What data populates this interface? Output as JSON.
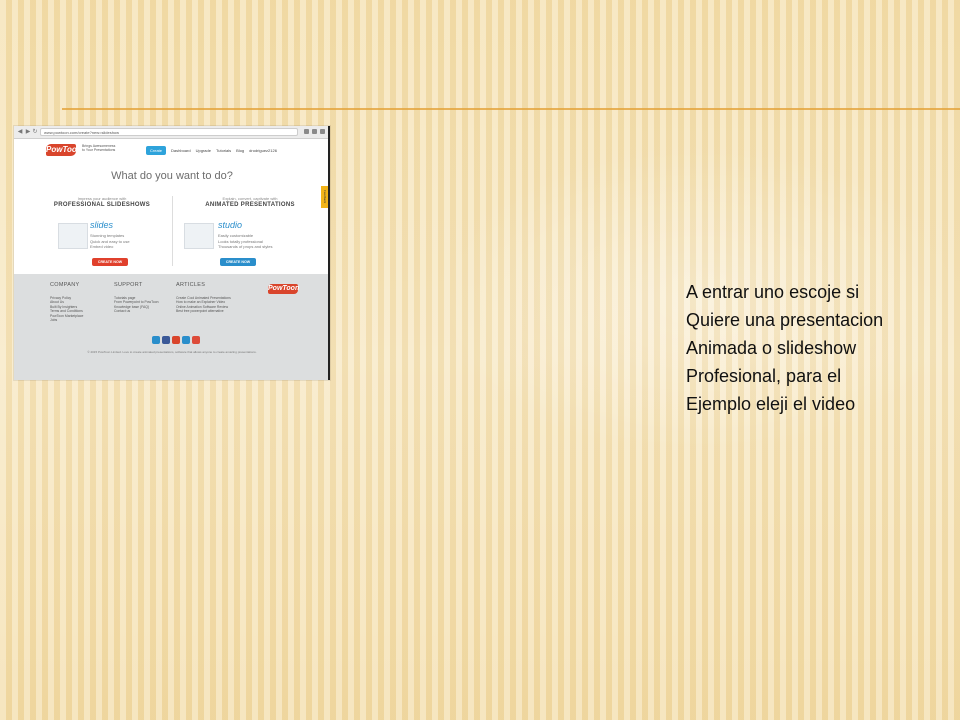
{
  "slide": {
    "caption_lines": [
      "A entrar uno escoje si",
      "Quiere una presentacion",
      "Animada o slideshow",
      "Profesional, para el",
      "Ejemplo eleji el video"
    ]
  },
  "browser": {
    "url": "www.powtoon.com/create?new=slideshow"
  },
  "site": {
    "logo": "PowToon",
    "tagline": "Brings Awesomeness to Your Presentations",
    "nav": [
      "Create",
      "Dashboard",
      "Upgrade",
      "Tutorials",
      "Blog",
      "drodriguez2126"
    ],
    "headline": "What do you want to do?",
    "left_col": {
      "lead": "Impress your audience with",
      "title": "PROFESSIONAL SLIDESHOWS",
      "product": "slides",
      "features": [
        "Stunning templates",
        "Quick and easy to use",
        "Embed video"
      ],
      "cta": "CREATE NOW"
    },
    "right_col": {
      "lead": "Explain, convert, captivate with",
      "title": "ANIMATED PRESENTATIONS",
      "product": "studio",
      "features": [
        "Easily customizable",
        "Looks totally professional",
        "Thousands of props and styles"
      ],
      "cta": "CREATE NOW"
    },
    "feedback": "Feedback",
    "footer": {
      "company_title": "COMPANY",
      "company_links": [
        "Privacy Policy",
        "About Us",
        "Built By Insighters",
        "Terms and Conditions",
        "PowToon Marketplace",
        "Jobs"
      ],
      "support_title": "SUPPORT",
      "support_links": [
        "Tutorials page",
        "From Powerpoint to PowToon",
        "Knowledge base (FAQ)",
        "Contact us"
      ],
      "articles_title": "ARTICLES",
      "articles_links": [
        "Create Cool Animated Presentations",
        "How to make an Explainer Video",
        "Online Animation Software Review",
        "Best free powerpoint alternative"
      ],
      "logo": "PowToon",
      "copyright": "© 2015 PowToon Limited. Love to create animated presentations, software that allows anyone to create amazing presentations."
    }
  },
  "colors": {
    "accent_rule": "#e3a23a",
    "brand_red": "#d9452c",
    "brand_blue": "#2a8ecb",
    "social": [
      "#2a8ecb",
      "#3b5998",
      "#d9452c",
      "#2a8ecb",
      "#dd4b39"
    ]
  }
}
